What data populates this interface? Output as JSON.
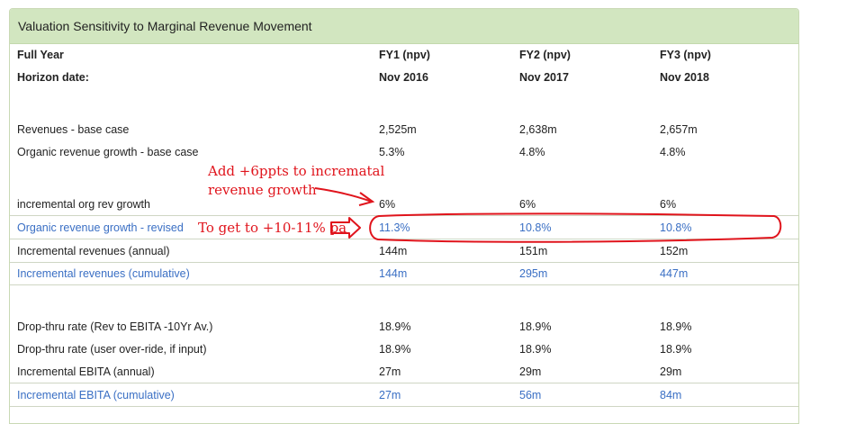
{
  "panel": {
    "title": "Valuation Sensitivity to Marginal Revenue Movement"
  },
  "header_rows": [
    {
      "label": "Full Year",
      "values": [
        "FY1 (npv)",
        "FY2 (npv)",
        "FY3 (npv)"
      ]
    },
    {
      "label": "Horizon date:",
      "values": [
        "Nov 2016",
        "Nov 2017",
        "Nov 2018"
      ]
    }
  ],
  "rows": [
    {
      "label": "Revenues - base case",
      "values": [
        "2,525m",
        "2,638m",
        "2,657m"
      ]
    },
    {
      "label": "Organic revenue growth - base case",
      "values": [
        "5.3%",
        "4.8%",
        "4.8%"
      ]
    },
    {
      "label": "incremental org rev growth",
      "values": [
        "6%",
        "6%",
        "6%"
      ]
    },
    {
      "label": "Organic revenue growth - revised",
      "values": [
        "11.3%",
        "10.8%",
        "10.8%"
      ]
    },
    {
      "label": "Incremental revenues (annual)",
      "values": [
        "144m",
        "151m",
        "152m"
      ]
    },
    {
      "label": "Incremental revenues (cumulative)",
      "values": [
        "144m",
        "295m",
        "447m"
      ]
    },
    {
      "label": "Drop-thru rate (Rev to EBITA -10Yr Av.)",
      "values": [
        "18.9%",
        "18.9%",
        "18.9%"
      ]
    },
    {
      "label": "Drop-thru rate (user over-ride, if input)",
      "values": [
        "18.9%",
        "18.9%",
        "18.9%"
      ]
    },
    {
      "label": "Incremental EBITA (annual)",
      "values": [
        "27m",
        "29m",
        "29m"
      ]
    },
    {
      "label": "Incremental EBITA (cumulative)",
      "values": [
        "27m",
        "56m",
        "84m"
      ]
    }
  ],
  "annotations": {
    "note1_line1": "Add +6ppts to incrematal",
    "note1_line2": "revenue growth",
    "note2": "To get to +10-11% pa"
  },
  "colors": {
    "annotation": "#e0141c",
    "link_text": "#3a6fc4",
    "header_bg": "#d2e6c0"
  }
}
